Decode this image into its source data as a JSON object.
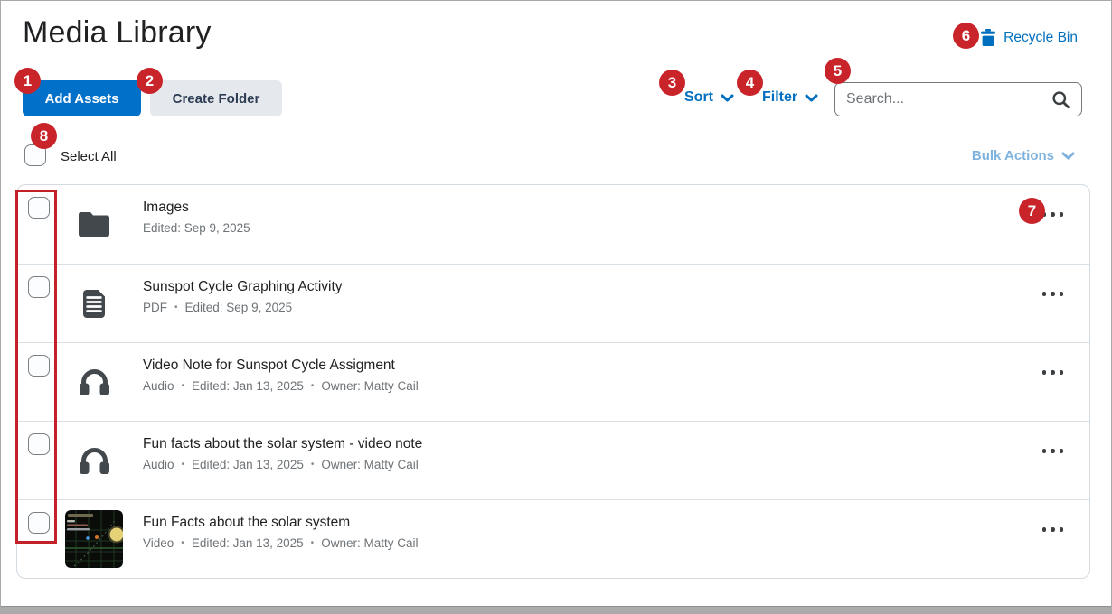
{
  "page": {
    "title": "Media Library"
  },
  "header": {
    "recycle_bin": "Recycle Bin"
  },
  "toolbar": {
    "add_assets": "Add Assets",
    "create_folder": "Create Folder",
    "sort": "Sort",
    "filter": "Filter",
    "search_placeholder": "Search..."
  },
  "list_header": {
    "select_all": "Select All",
    "bulk_actions": "Bulk Actions"
  },
  "annotations": {
    "badges": [
      "1",
      "2",
      "3",
      "4",
      "5",
      "6",
      "7",
      "8"
    ]
  },
  "items": [
    {
      "icon": "folder-icon",
      "title": "Images",
      "meta": [
        "Edited: Sep 9, 2025"
      ]
    },
    {
      "icon": "document-icon",
      "title": "Sunspot Cycle Graphing Activity",
      "meta": [
        "PDF",
        "Edited: Sep 9, 2025"
      ]
    },
    {
      "icon": "headphones-icon",
      "title": "Video Note for Sunspot Cycle Assigment",
      "meta": [
        "Audio",
        "Edited: Jan 13, 2025",
        "Owner: Matty Cail"
      ]
    },
    {
      "icon": "headphones-icon",
      "title": "Fun facts about the solar system - video note",
      "meta": [
        "Audio",
        "Edited: Jan 13, 2025",
        "Owner: Matty Cail"
      ]
    },
    {
      "icon": "video-thumbnail",
      "title": "Fun Facts about the solar system",
      "meta": [
        "Video",
        "Edited: Jan 13, 2025",
        "Owner: Matty Cail"
      ]
    }
  ],
  "icons": {
    "recycle_bin": "trash-icon",
    "sort": "chevron-down-icon",
    "filter": "chevron-down-icon",
    "search": "magnifier-icon",
    "bulk_actions": "chevron-down-icon",
    "row_actions": "ellipsis-icon"
  },
  "colors": {
    "accent_blue": "#006fbf",
    "primary_button_blue": "#0070c9",
    "annotation_red": "#c9242a",
    "bulk_actions_blue": "#7fb3de",
    "title_text": "#202122",
    "meta_text": "#6e7377"
  }
}
